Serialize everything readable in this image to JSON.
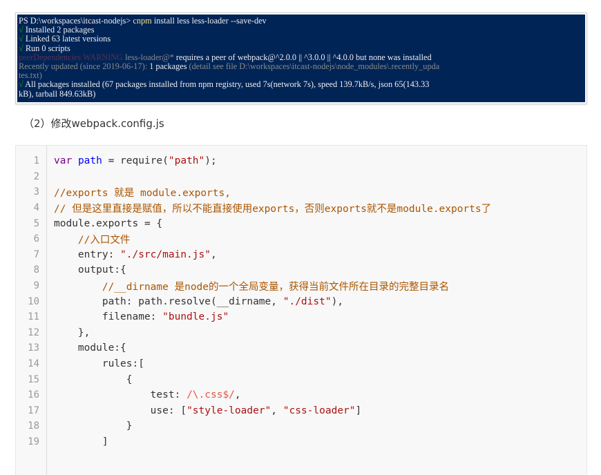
{
  "terminal": {
    "lines": [
      {
        "segments": [
          {
            "t": "PS D:\\workspaces\\itcast-nodejs> ",
            "c": ""
          },
          {
            "t": "cnpm",
            "c": "yellow"
          },
          {
            "t": " install less less-loader --save-dev",
            "c": ""
          }
        ]
      },
      {
        "segments": [
          {
            "t": "√",
            "c": "green"
          },
          {
            "t": " Installed 2 packages",
            "c": ""
          }
        ]
      },
      {
        "segments": [
          {
            "t": "√",
            "c": "green"
          },
          {
            "t": " Linked 63 latest versions",
            "c": ""
          }
        ]
      },
      {
        "segments": [
          {
            "t": "√",
            "c": "green"
          },
          {
            "t": " Run 0 scripts",
            "c": ""
          }
        ]
      },
      {
        "segments": [
          {
            "t": "peerDependencies WARNING",
            "c": "darkred"
          },
          {
            "t": " less-loader@*",
            "c": "gray"
          },
          {
            "t": " requires a peer of webpack@^2.0.0 || ^3.0.0 || ^4.0.0 but none was installed",
            "c": ""
          }
        ]
      },
      {
        "segments": [
          {
            "t": "Recently updated (since 2019-06-17): ",
            "c": "gray"
          },
          {
            "t": "1",
            "c": "yellow"
          },
          {
            "t": " packages",
            "c": ""
          },
          {
            "t": " (detail see file D:\\workspaces\\itcast-nodejs\\node_modules\\.recently_upda",
            "c": "gray"
          }
        ]
      },
      {
        "segments": [
          {
            "t": "tes.txt)",
            "c": "gray"
          }
        ]
      },
      {
        "segments": [
          {
            "t": "√",
            "c": "green"
          },
          {
            "t": " All packages installed (67 packages installed from npm registry, used 7s(network 7s), speed 139.7kB/s, json 65(143.33",
            "c": ""
          }
        ]
      },
      {
        "segments": [
          {
            "t": "kB), tarball 849.63kB)",
            "c": ""
          }
        ]
      }
    ]
  },
  "step": {
    "label": "（2）修改webpack.config.js"
  },
  "code": {
    "lines": [
      {
        "n": "1",
        "segments": [
          {
            "t": "var",
            "c": "kw"
          },
          {
            "t": " ",
            "c": ""
          },
          {
            "t": "path",
            "c": "def"
          },
          {
            "t": " = require(",
            "c": ""
          },
          {
            "t": "\"path\"",
            "c": "str"
          },
          {
            "t": ");",
            "c": ""
          }
        ]
      },
      {
        "n": "2",
        "segments": []
      },
      {
        "n": "3",
        "segments": [
          {
            "t": "//exports 就是 module.exports,",
            "c": "cm"
          }
        ]
      },
      {
        "n": "4",
        "segments": [
          {
            "t": "// 但是这里直接是赋值，所以不能直接使用exports，否则exports就不是module.exports了",
            "c": "cm"
          }
        ]
      },
      {
        "n": "5",
        "segments": [
          {
            "t": "module.exports = {",
            "c": ""
          }
        ]
      },
      {
        "n": "6",
        "segments": [
          {
            "t": "    ",
            "c": ""
          },
          {
            "t": "//入口文件",
            "c": "cm"
          }
        ]
      },
      {
        "n": "7",
        "segments": [
          {
            "t": "    entry: ",
            "c": ""
          },
          {
            "t": "\"./src/main.js\"",
            "c": "str"
          },
          {
            "t": ",",
            "c": ""
          }
        ]
      },
      {
        "n": "8",
        "segments": [
          {
            "t": "    output:{",
            "c": ""
          }
        ]
      },
      {
        "n": "9",
        "segments": [
          {
            "t": "        ",
            "c": ""
          },
          {
            "t": "//__dirname 是node的一个全局变量，获得当前文件所在目录的完整目录名",
            "c": "cm"
          }
        ]
      },
      {
        "n": "10",
        "segments": [
          {
            "t": "        path: path.resolve(__dirname, ",
            "c": ""
          },
          {
            "t": "\"./dist\"",
            "c": "str"
          },
          {
            "t": "),",
            "c": ""
          }
        ]
      },
      {
        "n": "11",
        "segments": [
          {
            "t": "        filename: ",
            "c": ""
          },
          {
            "t": "\"bundle.js\"",
            "c": "str"
          }
        ]
      },
      {
        "n": "12",
        "segments": [
          {
            "t": "    },",
            "c": ""
          }
        ]
      },
      {
        "n": "13",
        "segments": [
          {
            "t": "    module:{",
            "c": ""
          }
        ]
      },
      {
        "n": "14",
        "segments": [
          {
            "t": "        rules:[",
            "c": ""
          }
        ]
      },
      {
        "n": "15",
        "segments": [
          {
            "t": "            {",
            "c": ""
          }
        ]
      },
      {
        "n": "16",
        "segments": [
          {
            "t": "                test: ",
            "c": ""
          },
          {
            "t": "/\\.css$/",
            "c": "re"
          },
          {
            "t": ",",
            "c": ""
          }
        ]
      },
      {
        "n": "17",
        "segments": [
          {
            "t": "                use: [",
            "c": ""
          },
          {
            "t": "\"style-loader\"",
            "c": "str"
          },
          {
            "t": ", ",
            "c": ""
          },
          {
            "t": "\"css-loader\"",
            "c": "str"
          },
          {
            "t": "]",
            "c": ""
          }
        ]
      },
      {
        "n": "18",
        "segments": [
          {
            "t": "            }",
            "c": ""
          }
        ]
      },
      {
        "n": "19",
        "segments": [
          {
            "t": "        ]",
            "c": ""
          }
        ]
      },
      {
        "n": "",
        "segments": []
      }
    ]
  }
}
